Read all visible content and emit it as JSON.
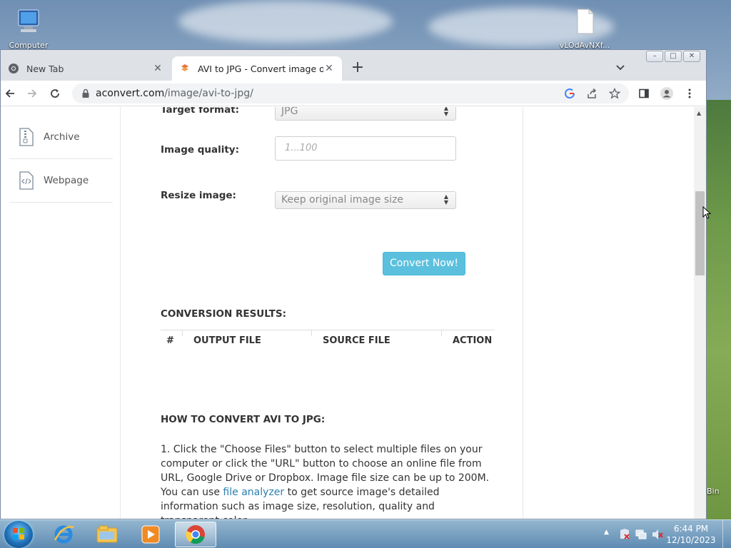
{
  "desktop": {
    "icons": [
      {
        "label": "Computer"
      },
      {
        "label": "vLOdAvNXf..."
      }
    ],
    "partial_text": "Bin"
  },
  "browser": {
    "tabs": [
      {
        "title": "New Tab",
        "active": false
      },
      {
        "title": "AVI to JPG - Convert image online",
        "active": true
      }
    ],
    "url_host": "aconvert.com",
    "url_path": "/image/avi-to-jpg/"
  },
  "sidebar": {
    "items": [
      {
        "label": "Archive",
        "icon": "archive-icon"
      },
      {
        "label": "Webpage",
        "icon": "webpage-icon"
      }
    ]
  },
  "form": {
    "target_format_label": "Target format:",
    "target_format_value": "JPG",
    "image_quality_label": "Image quality:",
    "image_quality_placeholder": "1...100",
    "resize_label": "Resize image:",
    "resize_value": "Keep original image size",
    "convert_button": "Convert Now!"
  },
  "results": {
    "title": "CONVERSION RESULTS:",
    "columns": [
      "#",
      "OUTPUT FILE",
      "SOURCE FILE",
      "ACTION"
    ]
  },
  "howto": {
    "title": "HOW TO CONVERT AVI TO JPG:",
    "para_before": "1. Click the \"Choose Files\" button to select multiple files on your computer or click the \"URL\" button to choose an online file from URL, Google Drive or Dropbox. Image file size can be up to 200M. You can use ",
    "link": "file analyzer",
    "para_after": " to get source image's detailed information such as image size, resolution, quality and transparent color."
  },
  "taskbar": {
    "time": "6:44 PM",
    "date": "12/10/2023"
  },
  "colors": {
    "accent": "#5bc0de",
    "link": "#2a7fb0"
  }
}
